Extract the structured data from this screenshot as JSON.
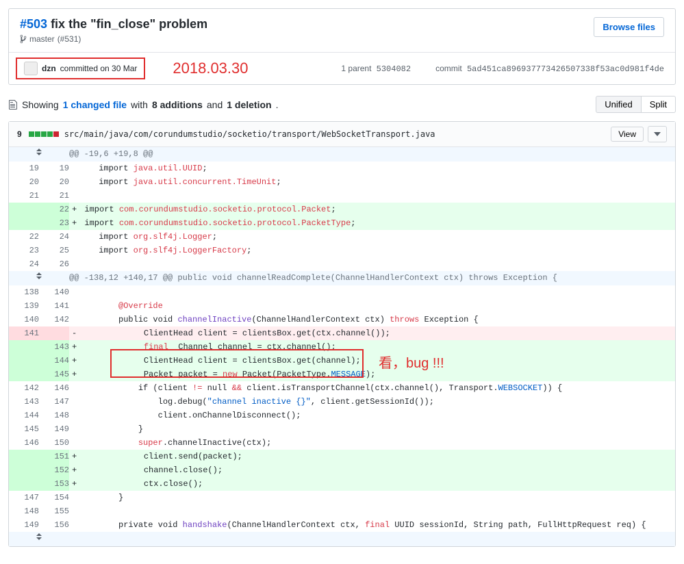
{
  "commit": {
    "issue_number": "#503",
    "title": "fix the \"fin_close\" problem",
    "branch_prefix": "master",
    "branch_ref": "(#531)",
    "browse_files": "Browse files",
    "author": "dzn",
    "committed_text": "committed on 30 Mar",
    "annotation_date": "2018.03.30",
    "parent_label": "1 parent",
    "parent_sha": "5304082",
    "commit_label": "commit",
    "commit_sha": "5ad451ca896937773426507338f53ac0d981f4de"
  },
  "summary": {
    "showing": "Showing",
    "changed_files": "1 changed file",
    "with": "with",
    "additions": "8 additions",
    "and": "and",
    "deletions": "1 deletion",
    "period": ".",
    "unified": "Unified",
    "split": "Split"
  },
  "file": {
    "changes": "9",
    "path": "src/main/java/com/corundumstudio/socketio/transport/WebSocketTransport.java",
    "view": "View"
  },
  "hunks": {
    "h1": "@@ -19,6 +19,8 @@",
    "h2": "@@ -138,12 +140,17 @@ public void channelReadComplete(ChannelHandlerContext ctx) throws Exception {"
  },
  "lines": {
    "l19a": "19",
    "l19b": "19",
    "l20a": "20",
    "l20b": "20",
    "l21a": "21",
    "l21b": "21",
    "a22": "22",
    "a23": "23",
    "l22a": "22",
    "l24b": "24",
    "l23a": "23",
    "l25b": "25",
    "l24a": "24",
    "l26b": "26",
    "l138a": "138",
    "l140b": "140",
    "l139a": "139",
    "l141b": "141",
    "l140a": "140",
    "l142b": "142",
    "d141": "141",
    "a143": "143",
    "a144": "144",
    "a145": "145",
    "l142a": "142",
    "l146b": "146",
    "l143a": "143",
    "l147b": "147",
    "l144a": "144",
    "l148b": "148",
    "l145a": "145",
    "l149b": "149",
    "l146a": "146",
    "l150b": "150",
    "a151": "151",
    "a152": "152",
    "a153": "153",
    "l147a": "147",
    "l154b": "154",
    "l148a": "148",
    "l155b": "155",
    "l149a": "149",
    "l156b": "156"
  },
  "code": {
    "c1_pre": "      import ",
    "c1_mid": "java.util.UUID",
    "c1_suf": ";",
    "c2_pre": "      import ",
    "c2_mid": "java.util.concurrent.TimeUnit",
    "c2_suf": ";",
    "empty": "",
    "a1_mark": "+",
    "a1_pre": " import ",
    "a1_mid": "com.corundumstudio.socketio.protocol.Packet",
    "a1_suf": ";",
    "a2_mark": "+",
    "a2_pre": " import ",
    "a2_mid": "com.corundumstudio.socketio.protocol.PacketType",
    "a2_suf": ";",
    "c3_pre": "      import ",
    "c3_mid": "org.slf4j.Logger",
    "c3_suf": ";",
    "c4_pre": "      import ",
    "c4_mid": "org.slf4j.LoggerFactory",
    "c4_suf": ";",
    "ov": "          @Override",
    "pub_pre": "          public void ",
    "pub_fn": "channelInactive",
    "pub_mid": "(ChannelHandlerContext ctx) ",
    "pub_throws": "throws",
    "pub_suf": " Exception {",
    "del_mark": "-",
    "del_txt": "             ClientHead client = clientsBox.get(ctx.channel());",
    "a3_mark": "+",
    "a3_pre": "             ",
    "a3_kw": "final",
    "a3_mid": "  Channel channel = ctx.channel();",
    "a4_mark": "+",
    "a4_txt": "             ClientHead client = clientsBox.get(channel);",
    "a5_mark": "+",
    "a5_pre": "             Packet packet = ",
    "a5_new": "new",
    "a5_mid": " Packet(PacketType.",
    "a5_msg": "MESSAGE",
    "a5_suf": ");",
    "if_pre": "              if (client ",
    "if_ne": "!=",
    "if_mid": " null ",
    "if_and": "&&",
    "if_mid2": " client.isTransportChannel(ctx.channel(), Transport.",
    "if_ws": "WEBSOCKET",
    "if_suf": ")) {",
    "log_pre": "                  log.debug(",
    "log_str": "\"channel inactive {}\"",
    "log_suf": ", client.getSessionId());",
    "disc": "                  client.onChannelDisconnect();",
    "close_brace": "              }",
    "super_pre": "              ",
    "super_kw": "super",
    "super_suf": ".channelInactive(ctx);",
    "a6_mark": "+",
    "a6_txt": "             client.send(packet);",
    "a7_mark": "+",
    "a7_txt": "             channel.close();",
    "a8_mark": "+",
    "a8_txt": "             ctx.close();",
    "close2": "          }",
    "hs_pre": "          private void ",
    "hs_fn": "handshake",
    "hs_mid": "(ChannelHandlerContext ctx, ",
    "hs_final": "final",
    "hs_mid2": " UUID sessionId, String path, FullHttpRequest req) {"
  },
  "annotations": {
    "bug_text": "看，bug !!!"
  }
}
